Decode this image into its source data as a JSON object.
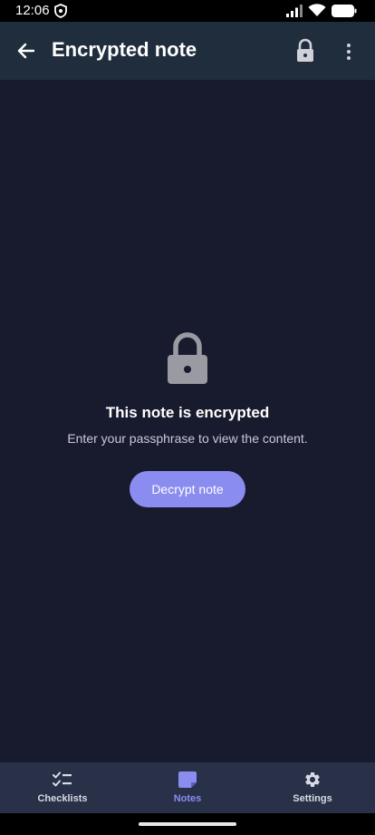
{
  "status_bar": {
    "time": "12:06",
    "icons": [
      "shield-icon",
      "signal-icon",
      "wifi-icon",
      "battery-icon"
    ]
  },
  "app_bar": {
    "title": "Encrypted note",
    "icons": [
      "back-arrow-icon",
      "lock-icon",
      "more-vert-icon"
    ]
  },
  "encrypted_state": {
    "icon": "lock-icon",
    "title": "This note is encrypted",
    "subtitle": "Enter your passphrase to view the content.",
    "button_label": "Decrypt note"
  },
  "bottom_nav": {
    "items": [
      {
        "label": "Checklists",
        "icon": "checklist-icon",
        "active": false
      },
      {
        "label": "Notes",
        "icon": "note-icon",
        "active": true
      },
      {
        "label": "Settings",
        "icon": "gear-icon",
        "active": false
      }
    ]
  },
  "colors": {
    "app_bar": "#1f2d3d",
    "background": "#181a2e",
    "accent": "#8a8cf0",
    "bottom_nav": "#283148"
  }
}
